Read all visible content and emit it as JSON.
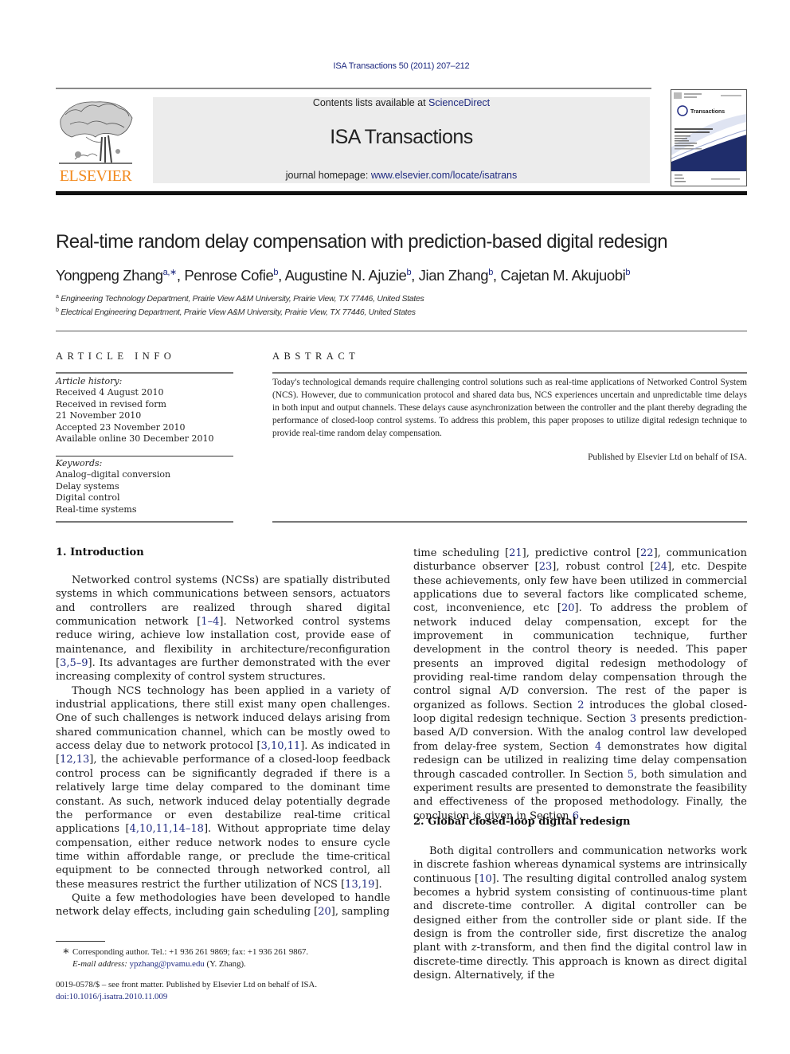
{
  "header": {
    "journal_ref": "ISA Transactions 50 (2011) 207–212",
    "publisher_logo_text": "ELSEVIER",
    "contents_prefix": "Contents lists available at ",
    "contents_link": "ScienceDirect",
    "journal_title": "ISA Transactions",
    "homepage_prefix": "journal homepage: ",
    "homepage_link": "www.elsevier.com/locate/isatrans",
    "cover_title": "Transactions",
    "colors": {
      "link": "#1f2a80",
      "elsevier_orange": "#f28a1e",
      "banner_bg": "#ececec"
    }
  },
  "article": {
    "title": "Real-time random delay compensation with prediction-based digital redesign",
    "authors": [
      {
        "name": "Yongpeng Zhang",
        "sup": "a,∗"
      },
      {
        "name": "Penrose Cofie",
        "sup": "b"
      },
      {
        "name": "Augustine N. Ajuzie",
        "sup": "b"
      },
      {
        "name": "Jian Zhang",
        "sup": "b"
      },
      {
        "name": "Cajetan M. Akujuobi",
        "sup": "b"
      }
    ],
    "affiliations": [
      {
        "mark": "a",
        "text": "Engineering Technology Department, Prairie View A&M University, Prairie View, TX 77446, United States"
      },
      {
        "mark": "b",
        "text": "Electrical Engineering Department, Prairie View A&M University, Prairie View, TX 77446, United States"
      }
    ]
  },
  "article_info": {
    "heading": "ARTICLE INFO",
    "history_label": "Article history:",
    "history": [
      "Received 4 August 2010",
      "Received in revised form",
      "21 November 2010",
      "Accepted 23 November 2010",
      "Available online 30 December 2010"
    ],
    "keywords_label": "Keywords:",
    "keywords": [
      "Analog–digital conversion",
      "Delay systems",
      "Digital control",
      "Real-time systems"
    ]
  },
  "abstract": {
    "heading": "ABSTRACT",
    "text": "Today's technological demands require challenging control solutions such as real-time applications of Networked Control System (NCS). However, due to communication protocol and shared data bus, NCS experiences uncertain and unpredictable time delays in both input and output channels. These delays cause asynchronization between the controller and the plant thereby degrading the performance of closed-loop control systems. To address this problem, this paper proposes to utilize digital redesign technique to provide real-time random delay compensation.",
    "published_by": "Published by Elsevier Ltd on behalf of ISA."
  },
  "sections": {
    "s1_heading": "1.  Introduction",
    "s1_p1": [
      {
        "t": "Networked control systems (NCSs) are spatially distributed systems in which communications between sensors, actuators and controllers are realized through shared digital communication network ["
      },
      {
        "t": "1–4",
        "link": true
      },
      {
        "t": "]. Networked control systems reduce wiring, achieve low installation cost, provide ease of maintenance, and flexibility in architecture/reconfiguration ["
      },
      {
        "t": "3,5–9",
        "link": true
      },
      {
        "t": "]. Its advantages are further demonstrated with the ever increasing complexity of control system structures."
      }
    ],
    "s1_p2": [
      {
        "t": "Though NCS technology has been applied in a variety of industrial applications, there still exist many open challenges. One of such challenges is network induced delays arising from shared communication channel, which can be mostly owed to access delay due to network protocol ["
      },
      {
        "t": "3,10,11",
        "link": true
      },
      {
        "t": "]. As indicated in ["
      },
      {
        "t": "12,13",
        "link": true
      },
      {
        "t": "], the achievable performance of a closed-loop feedback control process can be significantly degraded if there is a relatively large time delay compared to the dominant time constant. As such, network induced delay potentially degrade the performance or even destabilize real-time critical applications ["
      },
      {
        "t": "4,10,11,14–18",
        "link": true
      },
      {
        "t": "]. Without appropriate time delay compensation, either reduce network nodes to ensure cycle time within affordable range, or preclude the time-critical equipment to be connected through networked control, all these measures restrict the further utilization of NCS ["
      },
      {
        "t": "13,19",
        "link": true
      },
      {
        "t": "]."
      }
    ],
    "s1_p3": [
      {
        "t": "Quite a few methodologies have been developed to handle network delay effects, including gain scheduling ["
      },
      {
        "t": "20",
        "link": true
      },
      {
        "t": "], sampling time scheduling ["
      },
      {
        "t": "21",
        "link": true
      },
      {
        "t": "], predictive control ["
      },
      {
        "t": "22",
        "link": true
      },
      {
        "t": "], communication disturbance observer ["
      },
      {
        "t": "23",
        "link": true
      },
      {
        "t": "], robust control ["
      },
      {
        "t": "24",
        "link": true
      },
      {
        "t": "], etc. Despite these achievements, only few have been utilized in commercial applications due to several factors like complicated scheme, cost, inconvenience, etc ["
      },
      {
        "t": "20",
        "link": true
      },
      {
        "t": "]. To address the problem of network induced delay compensation, except for the improvement in communication technique, further development in the control theory is needed. This paper presents an improved digital redesign methodology of providing real-time random delay compensation through the control signal A/D conversion. The rest of the paper is organized as follows. Section "
      },
      {
        "t": "2",
        "link": true
      },
      {
        "t": " introduces the global closed-loop digital redesign technique. Section "
      },
      {
        "t": "3",
        "link": true
      },
      {
        "t": " presents prediction-based A/D conversion. With the analog control law developed from delay-free system, Section "
      },
      {
        "t": "4",
        "link": true
      },
      {
        "t": " demonstrates how digital redesign can be utilized in realizing time delay compensation through cascaded controller. In Section "
      },
      {
        "t": "5",
        "link": true
      },
      {
        "t": ", both simulation and experiment results are presented to demonstrate the feasibility and effectiveness of the proposed methodology. Finally, the conclusion is given in Section "
      },
      {
        "t": "6",
        "link": true
      },
      {
        "t": "."
      }
    ],
    "s2_heading": "2.  Global closed-loop digital redesign",
    "s2_p1": [
      {
        "t": "Both digital controllers and communication networks work in discrete fashion whereas dynamical systems are intrinsically continuous ["
      },
      {
        "t": "10",
        "link": true
      },
      {
        "t": "]. The resulting digital controlled analog system becomes a hybrid system consisting of continuous-time plant and discrete-time controller. A digital controller can be designed either from the controller side or plant side.  If the design is from the controller side, first discretize the analog plant with "
      },
      {
        "t": "z",
        "italic": true
      },
      {
        "t": "-transform, and then find the digital control law in discrete-time directly. This approach is known as direct digital design. Alternatively, if the"
      }
    ]
  },
  "footnote": {
    "star": "∗",
    "corresponding": "Corresponding author. Tel.: +1 936 261 9869; fax: +1 936 261 9867.",
    "email_label": "E-mail address:",
    "email": "ypzhang@pvamu.edu",
    "email_suffix": " (Y. Zhang).",
    "issn": "0019-0578/$ – see front matter.  Published by Elsevier Ltd on behalf of ISA.",
    "doi": "doi:10.1016/j.isatra.2010.11.009"
  }
}
